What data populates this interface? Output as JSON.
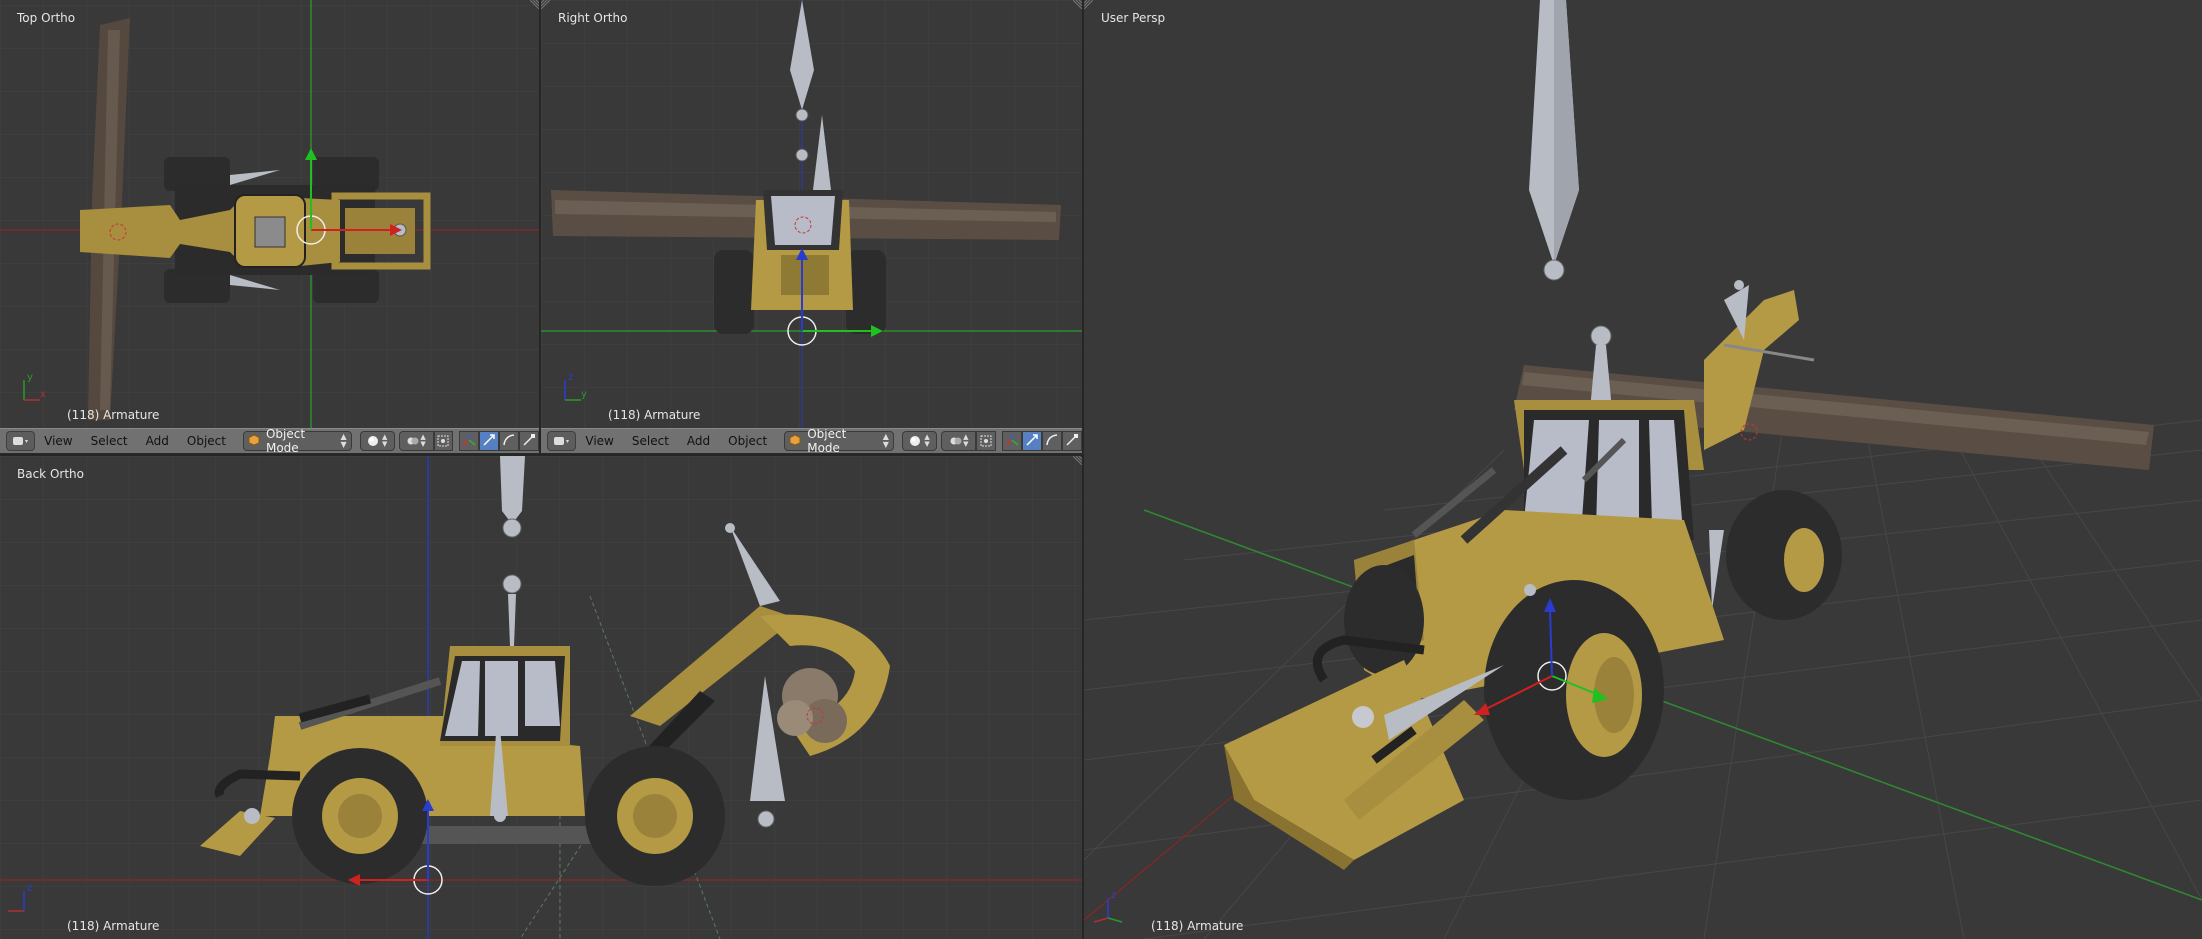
{
  "viewports": {
    "top": {
      "label": "Top Ortho",
      "status": "(118) Armature"
    },
    "right": {
      "label": "Right Ortho",
      "status": "(118) Armature"
    },
    "back": {
      "label": "Back Ortho",
      "status": "(118) Armature"
    },
    "persp": {
      "label": "User Persp",
      "status": "(118) Armature"
    }
  },
  "header": {
    "menu": [
      "View",
      "Select",
      "Add",
      "Object"
    ],
    "mode": "Object Mode"
  },
  "colors": {
    "viewport_bg": "#393939",
    "header_bg": "#717171",
    "grid_line": "#454545",
    "x_axis": "#8a2b2b",
    "y_axis": "#3c8c3c",
    "z_axis": "#2a3cb4",
    "machine_yellow": "#b59a45",
    "tire": "#2d2d2d",
    "log": "#5a4e44",
    "bone": "#b8bcc4",
    "active_blue": "#5680c2"
  },
  "icons": [
    "editor-type-icon",
    "object-mode-icon",
    "shading-sphere-icon",
    "pivot-icon",
    "layer-select-icon",
    "manipulator-axes-icon",
    "translate-icon",
    "rotate-icon",
    "scale-icon"
  ]
}
